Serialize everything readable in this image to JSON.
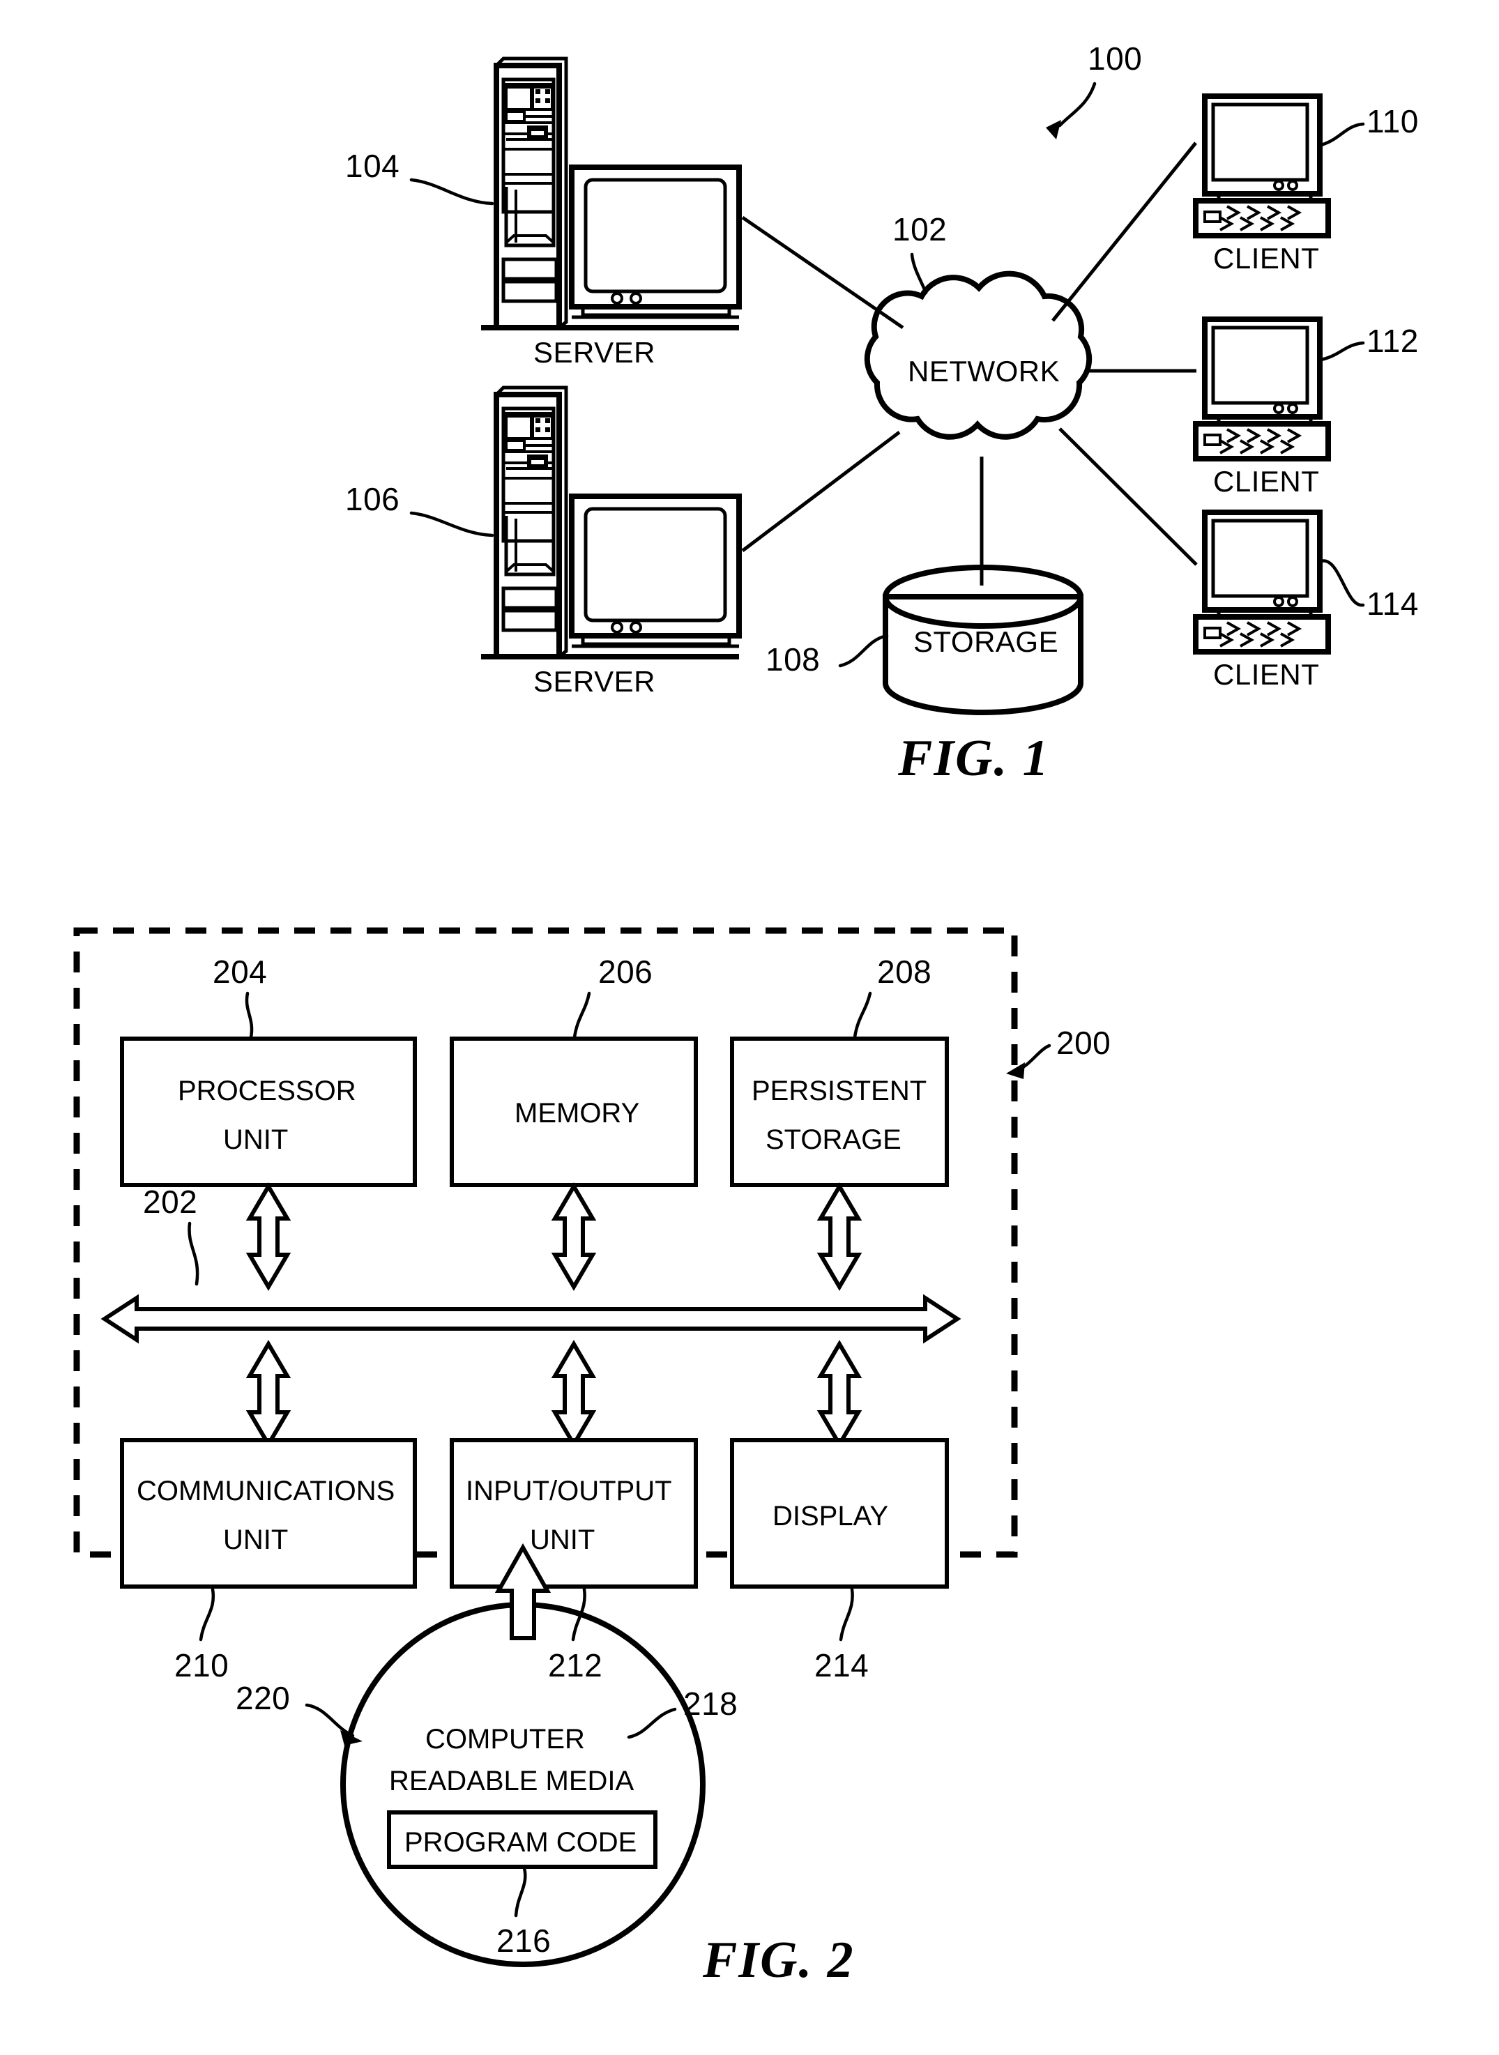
{
  "document": {
    "kind": "patent-drawing-sheet",
    "figures": [
      "FIG. 1",
      "FIG. 2"
    ]
  },
  "fig1": {
    "caption": "FIG. 1",
    "system_ref": "100",
    "network": {
      "label": "NETWORK",
      "ref": "102"
    },
    "storage": {
      "label": "STORAGE",
      "ref": "108"
    },
    "servers": [
      {
        "label": "SERVER",
        "ref": "104"
      },
      {
        "label": "SERVER",
        "ref": "106"
      }
    ],
    "clients": [
      {
        "label": "CLIENT",
        "ref": "110"
      },
      {
        "label": "CLIENT",
        "ref": "112"
      },
      {
        "label": "CLIENT",
        "ref": "114"
      }
    ]
  },
  "fig2": {
    "caption": "FIG. 2",
    "system_ref": "200",
    "bus": {
      "ref": "202"
    },
    "top_row": [
      {
        "lines": [
          "PROCESSOR",
          "UNIT"
        ],
        "ref": "204"
      },
      {
        "lines": [
          "MEMORY"
        ],
        "ref": "206"
      },
      {
        "lines": [
          "PERSISTENT",
          "STORAGE"
        ],
        "ref": "208"
      }
    ],
    "bottom_row": [
      {
        "lines": [
          "COMMUNICATIONS",
          "UNIT"
        ],
        "ref": "210"
      },
      {
        "lines": [
          "INPUT/OUTPUT",
          "UNIT"
        ],
        "ref": "212"
      },
      {
        "lines": [
          "DISPLAY"
        ],
        "ref": "214"
      }
    ],
    "media": {
      "lines": [
        "COMPUTER",
        "READABLE MEDIA"
      ],
      "ref": "218",
      "product_ref": "220",
      "program_code": {
        "label": "PROGRAM CODE",
        "ref": "216"
      }
    }
  }
}
